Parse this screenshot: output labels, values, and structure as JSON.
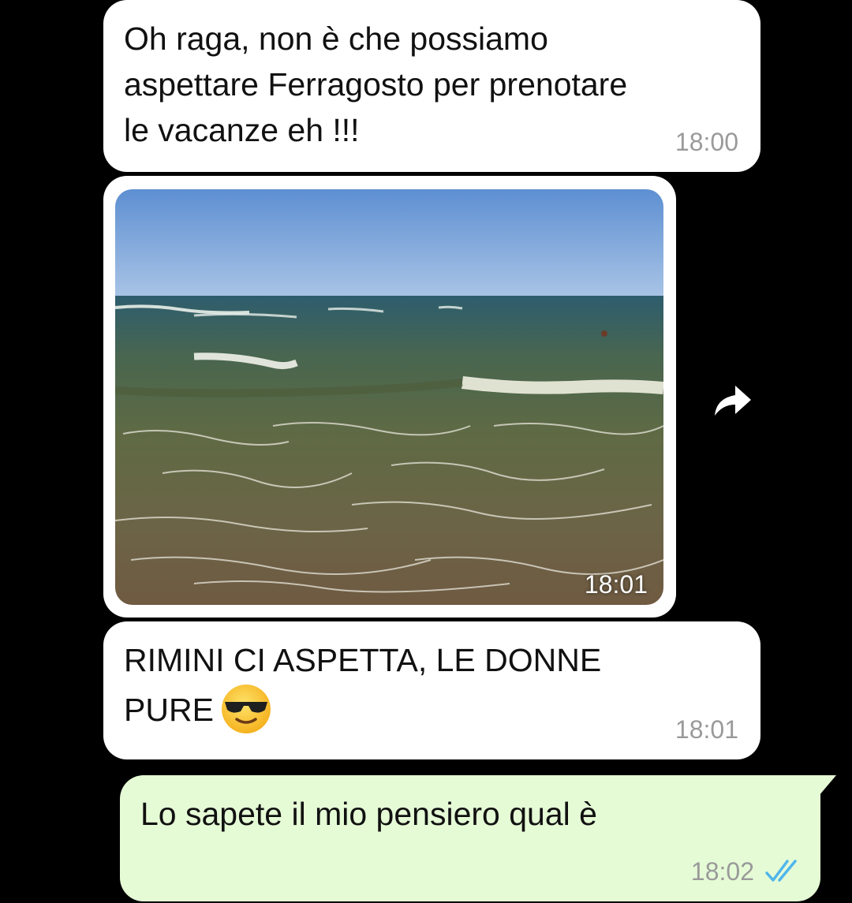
{
  "messages": [
    {
      "direction": "incoming",
      "type": "text",
      "text": "Oh raga, non è che possiamo\naspettare Ferragosto per prenotare\nle vacanze eh !!!",
      "time": "18:00"
    },
    {
      "direction": "incoming",
      "type": "image",
      "image_description_icon": "beach-sea-photo",
      "time": "18:01"
    },
    {
      "direction": "incoming",
      "type": "text",
      "text": "RIMINI CI ASPETTA, LE DONNE\nPURE",
      "emoji": "smiling-face-with-sunglasses",
      "time": "18:01"
    },
    {
      "direction": "outgoing",
      "type": "text",
      "text": "Lo sapete il mio pensiero qual è",
      "time": "18:02",
      "status": "read"
    }
  ],
  "icons": {
    "forward": "forward-arrow-icon",
    "read_receipt": "double-check-icon"
  },
  "colors": {
    "background": "#000000",
    "incoming_bubble": "#ffffff",
    "outgoing_bubble": "#e5fbd6",
    "read_ticks": "#4fb6ec",
    "timestamp": "#9a9a9a"
  }
}
